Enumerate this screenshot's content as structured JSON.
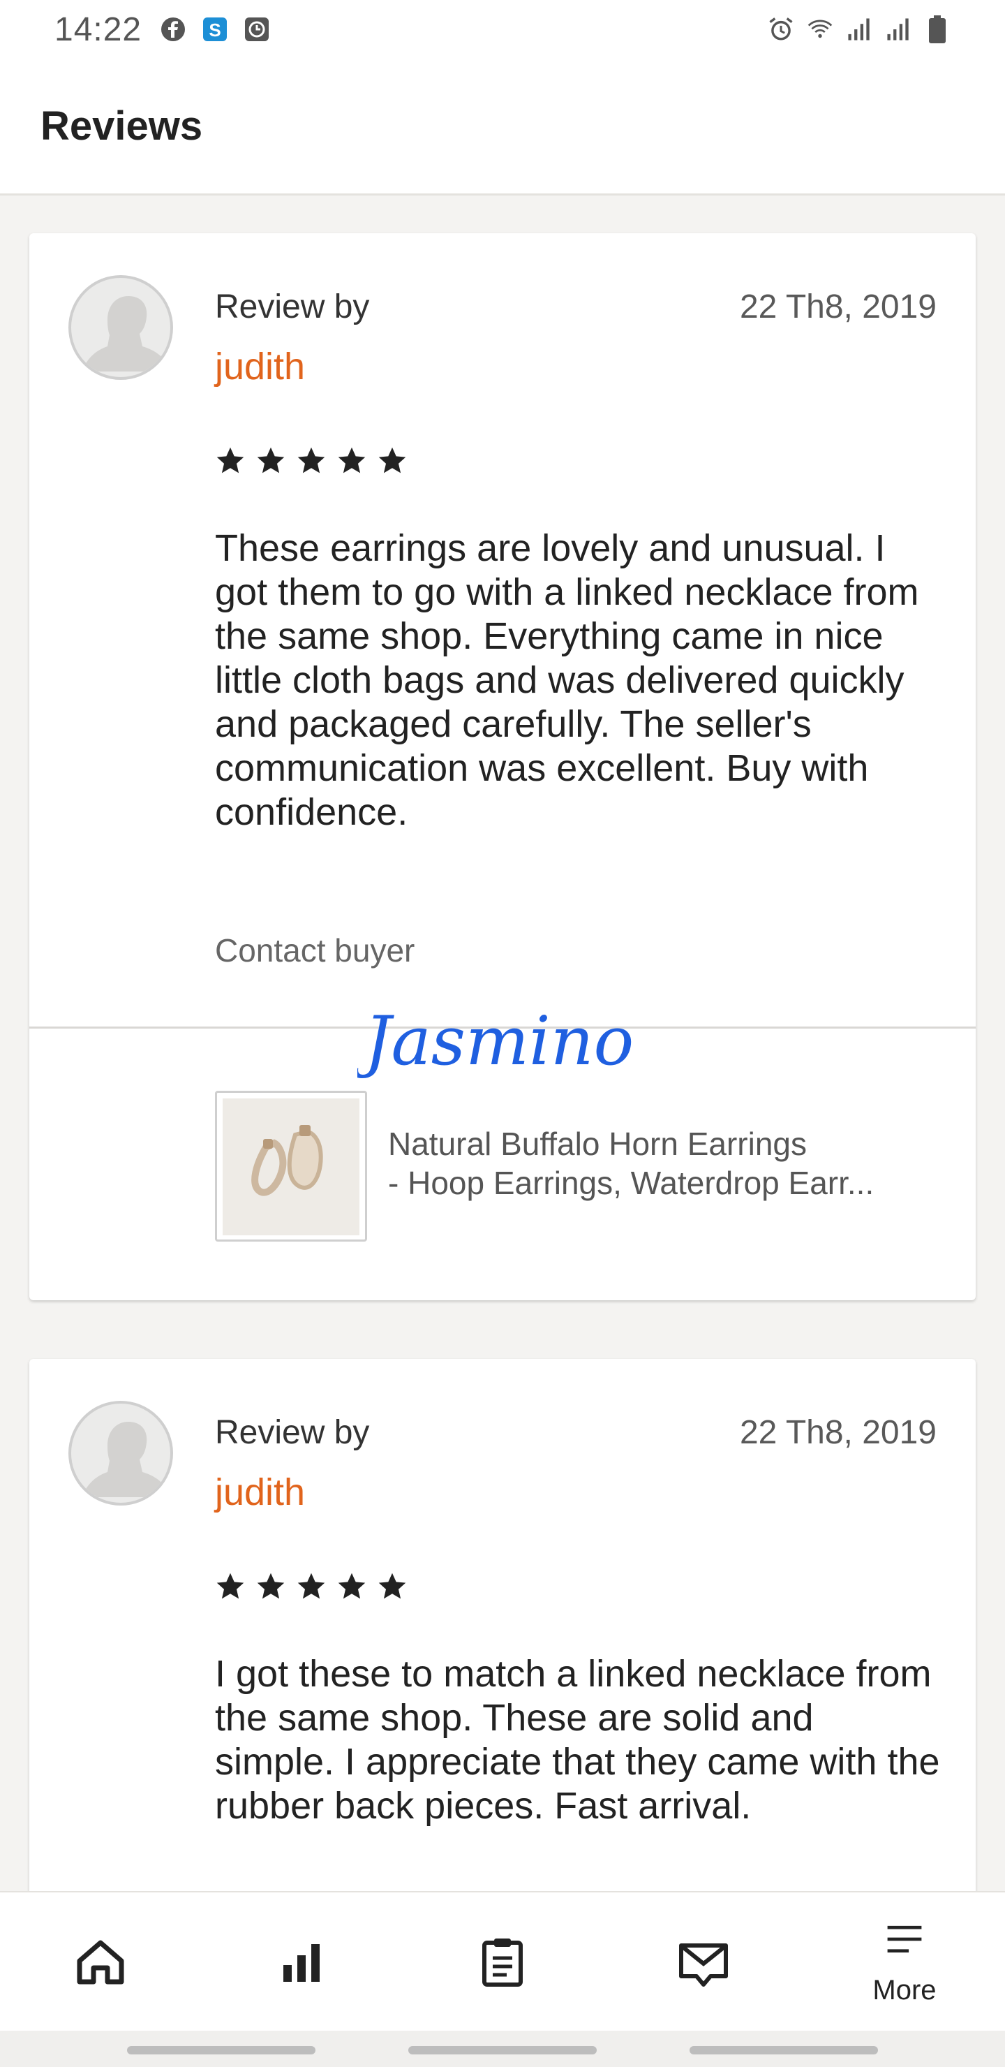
{
  "status_bar": {
    "time": "14:22",
    "left_icons": [
      "facebook-icon",
      "skype-icon",
      "clock-app-icon"
    ],
    "right_icons": [
      "alarm-icon",
      "wifi-icon",
      "signal-icon",
      "signal-icon",
      "battery-icon"
    ]
  },
  "header": {
    "title": "Reviews"
  },
  "reviews": [
    {
      "review_by_label": "Review by",
      "reviewer": "judith",
      "date": "22 Th8, 2019",
      "rating": 5,
      "stars_text": "★★★★★",
      "text": "These earrings are lovely and unusual.  I got them to go with a linked necklace from the same shop.  Everything came in nice little cloth bags and was delivered quickly and packaged carefully.  The seller's communication was excellent.  Buy with confidence.",
      "contact_label": "Contact buyer",
      "signature": "Jasmino",
      "product": {
        "title_line1": "Natural Buffalo Horn Earrings",
        "title_line2": "- Hoop Earrings, Waterdrop Earr..."
      }
    },
    {
      "review_by_label": "Review by",
      "reviewer": "judith",
      "date": "22 Th8, 2019",
      "rating": 5,
      "stars_text": "★★★★★",
      "text": "I got these to match a linked necklace from the same shop.  These are solid and simple.  I appreciate that they came with the rubber back pieces.  Fast arrival."
    }
  ],
  "nav": {
    "items": [
      {
        "icon": "home-icon",
        "label": ""
      },
      {
        "icon": "stats-icon",
        "label": ""
      },
      {
        "icon": "orders-icon",
        "label": ""
      },
      {
        "icon": "messages-icon",
        "label": ""
      },
      {
        "icon": "menu-icon",
        "label": "More"
      }
    ]
  },
  "colors": {
    "accent": "#e1641c",
    "signature": "#1f5fe0"
  }
}
